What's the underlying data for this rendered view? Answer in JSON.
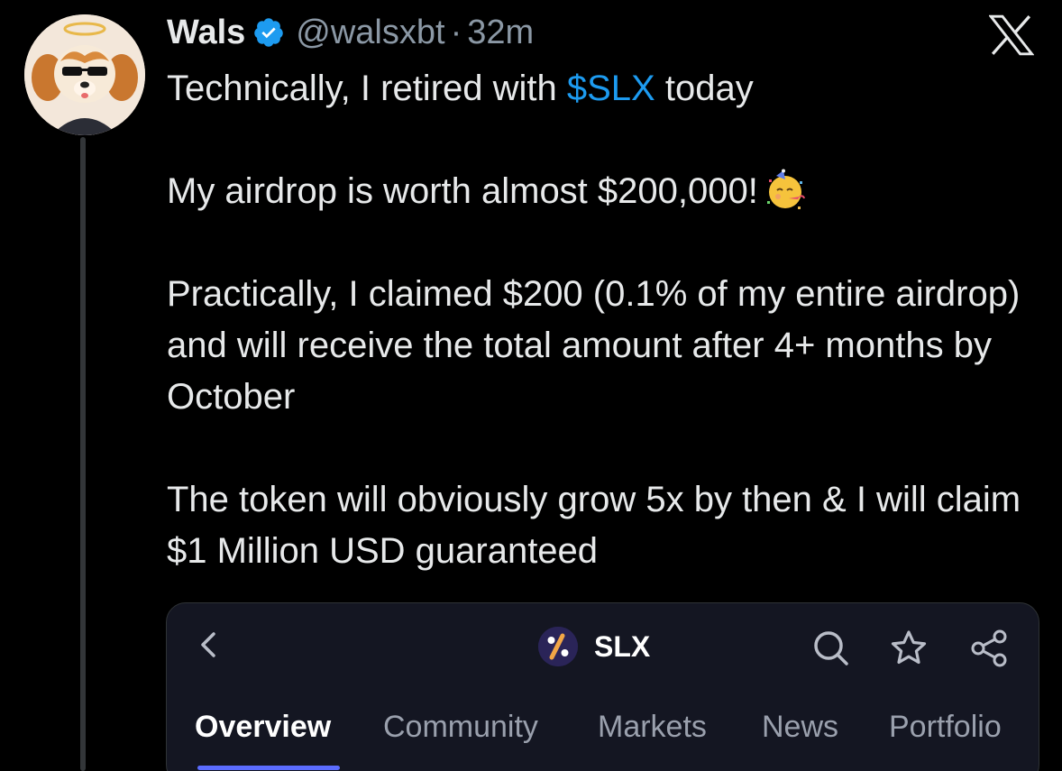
{
  "author": {
    "display_name": "Wals",
    "handle": "@walsxbt",
    "separator": "·",
    "time": "32m",
    "avatar_icon": "cartoon-dog-avatar",
    "verified_icon": "verified-badge-icon"
  },
  "platform_icon": "x-logo-icon",
  "tweet": {
    "line1_prefix": "Technically, I retired with ",
    "line1_cashtag": "$SLX",
    "line1_suffix": " today",
    "para2": "My airdrop is worth almost $200,000!",
    "para2_emoji": "partying-face-emoji",
    "para3": "Practically, I claimed $200 (0.1% of my entire airdrop) and will receive the total amount after 4+ months by October",
    "para4": "The token will obviously grow 5x by then & I will claim $1 Million USD guaranteed"
  },
  "card": {
    "token_name": "SLX",
    "token_icon": "slx-token-logo",
    "back_icon": "chevron-left-icon",
    "actions": [
      "search-icon",
      "star-icon",
      "share-icon"
    ],
    "tabs": [
      {
        "label": "Overview",
        "active": true
      },
      {
        "label": "Community",
        "active": false
      },
      {
        "label": "Markets",
        "active": false
      },
      {
        "label": "News",
        "active": false
      },
      {
        "label": "Portfolio",
        "active": false
      }
    ]
  },
  "colors": {
    "background": "#000000",
    "text": "#e7e9ea",
    "muted": "#8b98a5",
    "link": "#1d9bf0",
    "card_bg": "#141622",
    "tab_accent": "#5b6cff"
  }
}
